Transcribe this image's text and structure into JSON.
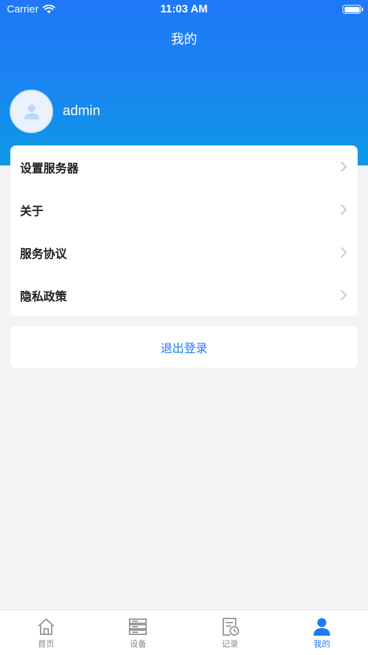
{
  "status_bar": {
    "carrier": "Carrier",
    "time": "11:03 AM"
  },
  "header": {
    "title": "我的"
  },
  "profile": {
    "username": "admin"
  },
  "menu": {
    "items": [
      {
        "label": "设置服务器"
      },
      {
        "label": "关于"
      },
      {
        "label": "服务协议"
      },
      {
        "label": "隐私政策"
      }
    ]
  },
  "logout": {
    "label": "退出登录"
  },
  "tabbar": {
    "tabs": [
      {
        "label": "首页",
        "icon": "home-icon"
      },
      {
        "label": "设备",
        "icon": "device-icon"
      },
      {
        "label": "记录",
        "icon": "record-icon"
      },
      {
        "label": "我的",
        "icon": "user-icon"
      }
    ],
    "active_index": 3
  },
  "colors": {
    "primary": "#1f78f6",
    "background": "#f3f3f3"
  }
}
